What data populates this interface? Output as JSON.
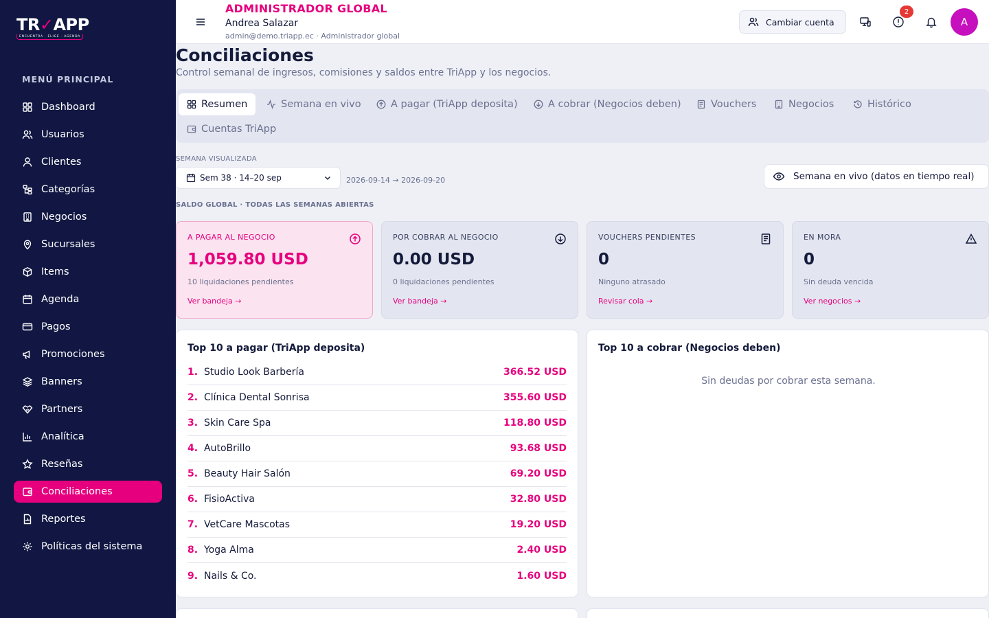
{
  "brand": {
    "logo_main": "TRIAPP",
    "logo_sub": "ENCUENTRA · ELIGE · AGENDA",
    "accent": "#e6007e"
  },
  "sidebar": {
    "section_label": "MENÚ PRINCIPAL",
    "items": [
      {
        "label": "Dashboard",
        "icon": "dashboard-icon"
      },
      {
        "label": "Usuarios",
        "icon": "users-icon"
      },
      {
        "label": "Clientes",
        "icon": "user-icon"
      },
      {
        "label": "Categorías",
        "icon": "categories-icon"
      },
      {
        "label": "Negocios",
        "icon": "building-icon"
      },
      {
        "label": "Sucursales",
        "icon": "map-pin-icon"
      },
      {
        "label": "Items",
        "icon": "box-icon"
      },
      {
        "label": "Agenda",
        "icon": "calendar-icon"
      },
      {
        "label": "Pagos",
        "icon": "credit-card-icon"
      },
      {
        "label": "Promociones",
        "icon": "megaphone-icon"
      },
      {
        "label": "Banners",
        "icon": "layers-icon"
      },
      {
        "label": "Partners",
        "icon": "handshake-icon"
      },
      {
        "label": "Analítica",
        "icon": "bar-chart-icon"
      },
      {
        "label": "Reseñas",
        "icon": "star-icon"
      },
      {
        "label": "Conciliaciones",
        "icon": "wallet-icon",
        "active": true
      },
      {
        "label": "Reportes",
        "icon": "report-icon"
      },
      {
        "label": "Políticas del sistema",
        "icon": "gear-icon"
      }
    ]
  },
  "header": {
    "role": "ADMINISTRADOR GLOBAL",
    "user_name": "Andrea Salazar",
    "user_meta": "admin@demo.triapp.ec · Administrador global",
    "switch_account": "Cambiar cuenta",
    "alerts_count": "2",
    "avatar_initial": "A"
  },
  "page": {
    "title": "Conciliaciones",
    "subtitle": "Control semanal de ingresos, comisiones y saldos entre TriApp y los negocios."
  },
  "tabs": [
    {
      "label": "Resumen",
      "active": true
    },
    {
      "label": "Semana en vivo"
    },
    {
      "label": "A pagar (TriApp deposita)"
    },
    {
      "label": "A cobrar (Negocios deben)"
    },
    {
      "label": "Vouchers"
    },
    {
      "label": "Negocios"
    },
    {
      "label": "Histórico"
    },
    {
      "label": "Cuentas TriApp"
    }
  ],
  "week": {
    "label": "SEMANA VISUALIZADA",
    "selected": "Sem 38 · 14–20 sep",
    "range": "2026-09-14 → 2026-09-20",
    "live_button": "Semana en vivo (datos en tiempo real)"
  },
  "global_label": "SALDO GLOBAL · TODAS LAS SEMANAS ABIERTAS",
  "kpis": [
    {
      "title": "A PAGAR AL NEGOCIO",
      "value": "1,059.80 USD",
      "sub": "10 liquidaciones pendientes",
      "link": "Ver bandeja →"
    },
    {
      "title": "POR COBRAR AL NEGOCIO",
      "value": "0.00 USD",
      "sub": "0 liquidaciones pendientes",
      "link": "Ver bandeja →"
    },
    {
      "title": "VOUCHERS PENDIENTES",
      "value": "0",
      "sub": "Ninguno atrasado",
      "link": "Revisar cola →"
    },
    {
      "title": "EN MORA",
      "value": "0",
      "sub": "Sin deuda vencida",
      "link": "Ver negocios →"
    }
  ],
  "top_pay": {
    "title": "Top 10 a pagar (TriApp deposita)",
    "rows": [
      {
        "rank": "1.",
        "name": "Studio Look Barbería",
        "amount": "366.52 USD"
      },
      {
        "rank": "2.",
        "name": "Clínica Dental Sonrisa",
        "amount": "355.60 USD"
      },
      {
        "rank": "3.",
        "name": "Skin Care Spa",
        "amount": "118.80 USD"
      },
      {
        "rank": "4.",
        "name": "AutoBrillo",
        "amount": "93.68 USD"
      },
      {
        "rank": "5.",
        "name": "Beauty Hair Salón",
        "amount": "69.20 USD"
      },
      {
        "rank": "6.",
        "name": "FisioActiva",
        "amount": "32.80 USD"
      },
      {
        "rank": "7.",
        "name": "VetCare Mascotas",
        "amount": "19.20 USD"
      },
      {
        "rank": "8.",
        "name": "Yoga Alma",
        "amount": "2.40 USD"
      },
      {
        "rank": "9.",
        "name": "Nails & Co.",
        "amount": "1.60 USD"
      }
    ]
  },
  "top_collect": {
    "title": "Top 10 a cobrar (Negocios deben)",
    "empty": "Sin deudas por cobrar esta semana."
  }
}
